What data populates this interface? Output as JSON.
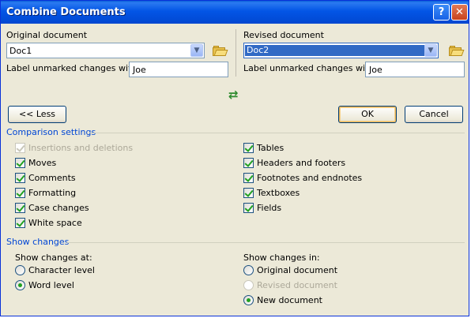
{
  "window": {
    "title": "Combine Documents",
    "help_glyph": "?",
    "close_glyph": "✕"
  },
  "original": {
    "label": "Original document",
    "value": "Doc1",
    "unmarked_label": "Label unmarked changes with:",
    "unmarked_value": "Joe"
  },
  "revised": {
    "label": "Revised document",
    "value": "Doc2",
    "unmarked_label": "Label unmarked changes with:",
    "unmarked_value": "Joe"
  },
  "swap_glyph": "⇄",
  "buttons": {
    "less": "<< Less",
    "ok": "OK",
    "cancel": "Cancel"
  },
  "comparison": {
    "heading": "Comparison settings",
    "left": [
      {
        "label": "Insertions and deletions",
        "checked": true,
        "disabled": true
      },
      {
        "label": "Moves",
        "checked": true,
        "disabled": false
      },
      {
        "label": "Comments",
        "checked": true,
        "disabled": false
      },
      {
        "label": "Formatting",
        "checked": true,
        "disabled": false
      },
      {
        "label": "Case changes",
        "checked": true,
        "disabled": false
      },
      {
        "label": "White space",
        "checked": true,
        "disabled": false
      }
    ],
    "right": [
      {
        "label": "Tables",
        "checked": true
      },
      {
        "label": "Headers and footers",
        "checked": true
      },
      {
        "label": "Footnotes and endnotes",
        "checked": true
      },
      {
        "label": "Textboxes",
        "checked": true
      },
      {
        "label": "Fields",
        "checked": true
      }
    ]
  },
  "show_changes": {
    "heading": "Show changes",
    "at_label": "Show changes at:",
    "at_options": [
      {
        "label": "Character level",
        "selected": false
      },
      {
        "label": "Word level",
        "selected": true
      }
    ],
    "in_label": "Show changes in:",
    "in_options": [
      {
        "label": "Original document",
        "selected": false,
        "disabled": false
      },
      {
        "label": "Revised document",
        "selected": false,
        "disabled": true
      },
      {
        "label": "New document",
        "selected": true,
        "disabled": false
      }
    ]
  },
  "colors": {
    "title_bar": "#0355e6",
    "section_heading": "#0046d5",
    "check": "#21a121"
  }
}
